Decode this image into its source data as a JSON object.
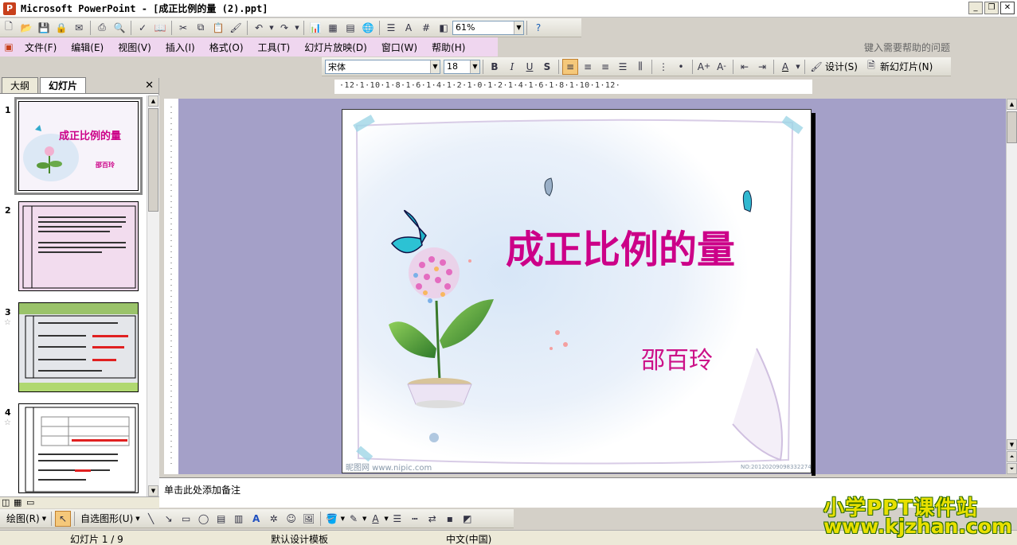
{
  "window": {
    "title": "Microsoft PowerPoint - [成正比例的量 (2).ppt]"
  },
  "toolbar": {
    "zoom": "61%"
  },
  "menu": {
    "items": [
      "文件(F)",
      "编辑(E)",
      "视图(V)",
      "插入(I)",
      "格式(O)",
      "工具(T)",
      "幻灯片放映(D)",
      "窗口(W)",
      "帮助(H)"
    ],
    "help_placeholder": "键入需要帮助的问题"
  },
  "format": {
    "font": "宋体",
    "size": "18",
    "bold": "B",
    "italic": "I",
    "underline": "U",
    "shadow": "S",
    "design_label": "设计(S)",
    "new_slide_label": "新幻灯片(N)"
  },
  "leftpane": {
    "tab_outline": "大纲",
    "tab_slides": "幻灯片",
    "thumbs": [
      {
        "num": "1",
        "title": "成正比例的量",
        "author": "邵百玲"
      },
      {
        "num": "2"
      },
      {
        "num": "3"
      },
      {
        "num": "4"
      }
    ]
  },
  "ruler": {
    "labels": "·12·1·10·1·8·1·6·1·4·1·2·1·0·1·2·1·4·1·6·1·8·1·10·1·12·"
  },
  "slide": {
    "title": "成正比例的量",
    "author": "邵百玲",
    "footer_left": "昵图网 www.nipic.com",
    "footer_right": "NO:20120209098332274385",
    "colors": {
      "title": "#cc0088"
    }
  },
  "notes": {
    "placeholder": "单击此处添加备注"
  },
  "draw": {
    "draw_label": "绘图(R)",
    "autoshapes_label": "自选图形(U)"
  },
  "status": {
    "slide": "幻灯片 1 / 9",
    "template": "默认设计模板",
    "language": "中文(中国)"
  },
  "watermark": {
    "line1": "小学PPT课件站",
    "line2": "www.kjzhan.com"
  }
}
